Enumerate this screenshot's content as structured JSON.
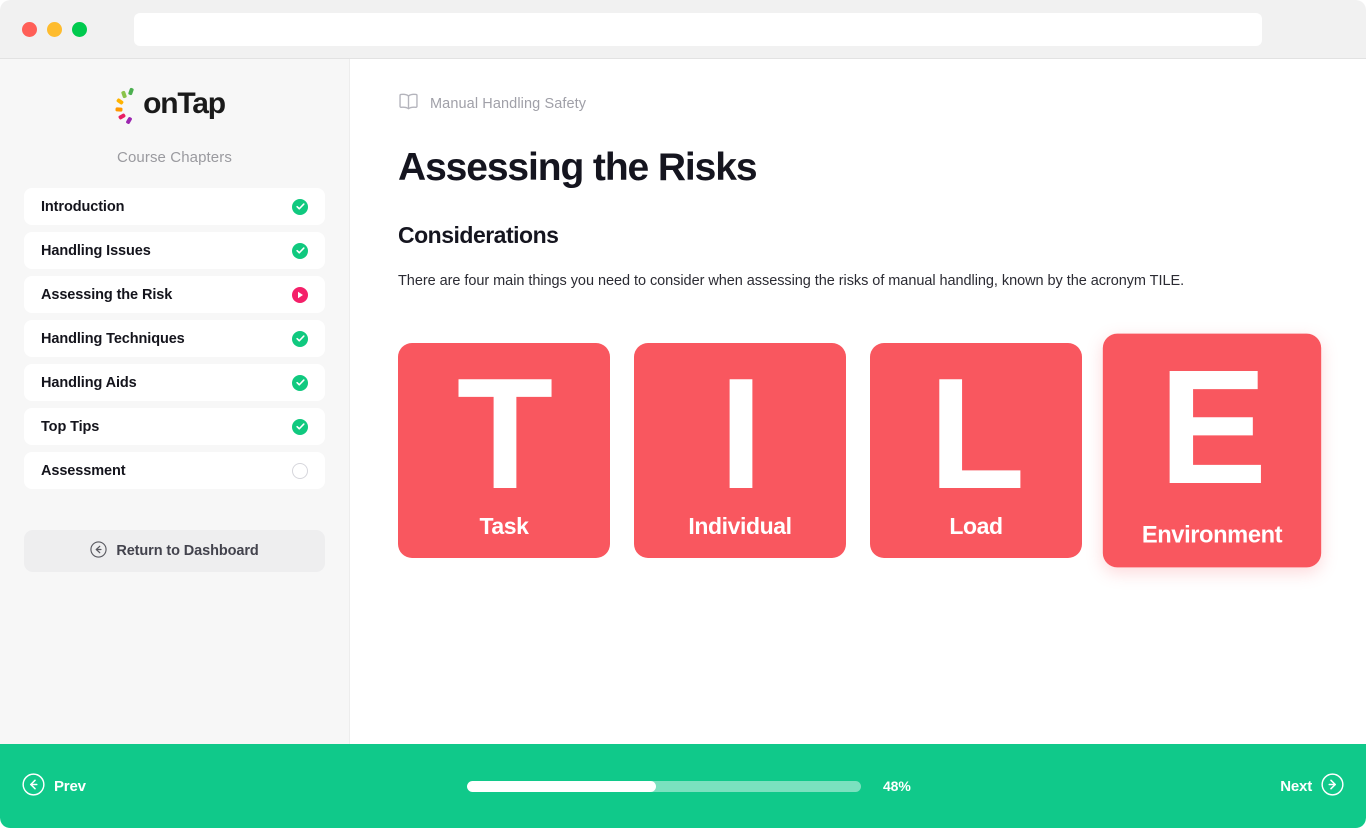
{
  "browser": {
    "url_value": "",
    "url_placeholder": "",
    "traffic_lights": [
      "close",
      "minimize",
      "maximize"
    ],
    "colors": {
      "close": "#ff5f57",
      "minimize": "#febc2e",
      "maximize": "#00ca4e"
    }
  },
  "sidebar": {
    "logo_text": "onTap",
    "section_label": "Course Chapters",
    "chapters": [
      {
        "label": "Introduction",
        "status": "done"
      },
      {
        "label": "Handling Issues",
        "status": "done"
      },
      {
        "label": "Assessing the Risk",
        "status": "current"
      },
      {
        "label": "Handling Techniques",
        "status": "done"
      },
      {
        "label": "Handling Aids",
        "status": "done"
      },
      {
        "label": "Top Tips",
        "status": "done"
      },
      {
        "label": "Assessment",
        "status": "todo"
      }
    ],
    "return_button": "Return to Dashboard"
  },
  "main": {
    "breadcrumb": "Manual Handling Safety",
    "breadcrumb_icon": "book-icon",
    "title": "Assessing the Risks",
    "subheading": "Considerations",
    "body": "There are four main things you need to consider when assessing the risks of manual handling, known by the acronym TILE.",
    "tiles": [
      {
        "letter": "T",
        "name": "Task",
        "hovered": false
      },
      {
        "letter": "I",
        "name": "Individual",
        "hovered": false
      },
      {
        "letter": "L",
        "name": "Load",
        "hovered": false
      },
      {
        "letter": "E",
        "name": "Environment",
        "hovered": true
      }
    ]
  },
  "footer": {
    "prev_label": "Prev",
    "next_label": "Next",
    "progress_percent": 48,
    "progress_label": "48%"
  },
  "colors": {
    "accent_green": "#10c98a",
    "status_done": "#10c97f",
    "status_current": "#f42069",
    "tile_red": "#f9575f",
    "sidebar_bg": "#f7f7f7",
    "text_dark": "#15151f",
    "text_muted": "#a0a0a8"
  }
}
